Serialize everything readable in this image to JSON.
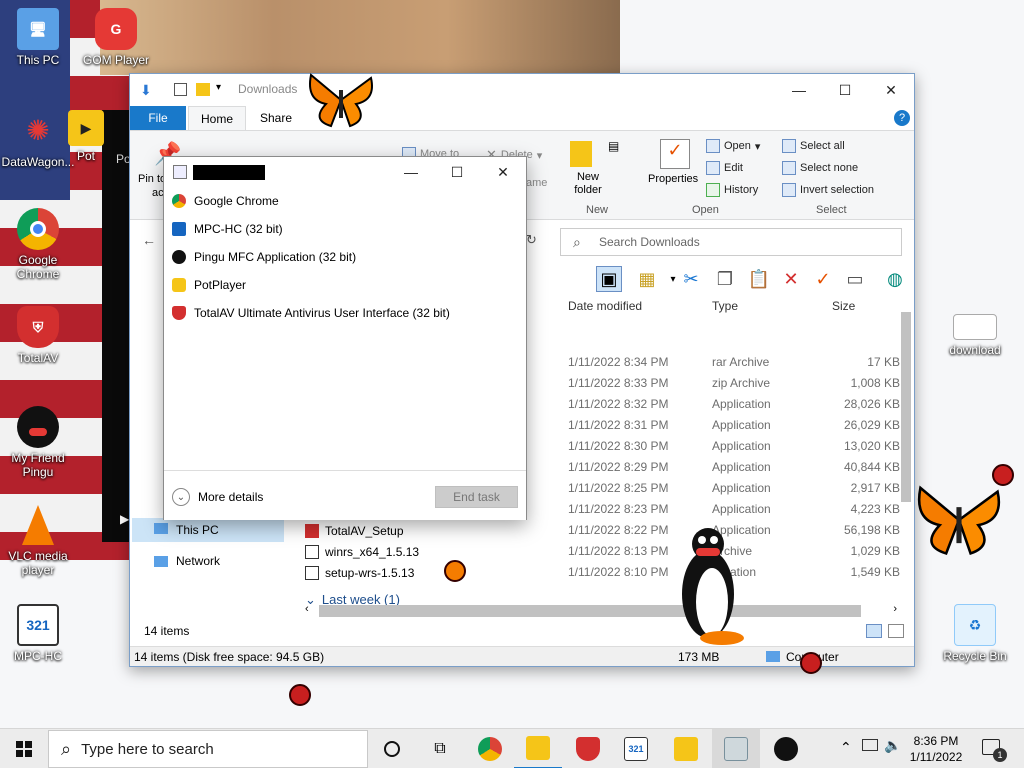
{
  "desktop": {
    "icons": [
      {
        "label": "This PC",
        "icon": "monitor-icon",
        "color": "#1e88e5"
      },
      {
        "label": "GOM Player",
        "icon": "gom-player-icon",
        "color": "#e53935"
      },
      {
        "label": "DataWagon...",
        "icon": "datawagon-icon",
        "color": "#e53935"
      },
      {
        "label": "Pot",
        "icon": "potplayer-icon",
        "color": "#f5c518"
      },
      {
        "label": "Google Chrome",
        "icon": "chrome-icon",
        "color": "#4caf50"
      },
      {
        "label": "TotalAV",
        "icon": "totalav-icon",
        "color": "#d32f2f"
      },
      {
        "label": "My Friend Pingu",
        "icon": "pingu-icon",
        "color": "#111111"
      },
      {
        "label": "VLC media player",
        "icon": "vlc-icon",
        "color": "#f57c00"
      },
      {
        "label": "MPC-HC",
        "icon": "mpc-hc-icon",
        "color": "#1565c0"
      },
      {
        "label": "download",
        "icon": "image-file-icon",
        "color": "#ffffff"
      },
      {
        "label": "Recycle Bin",
        "icon": "recycle-bin-icon",
        "color": "#90caf9"
      }
    ],
    "gom_window_label": "Po"
  },
  "explorer": {
    "title": "Downloads",
    "tabs": {
      "file": "File",
      "home": "Home",
      "share": "Share"
    },
    "ribbon": {
      "pin": "Pin to",
      "pin2": "ac",
      "move_to": "Move to",
      "delete": "Delete",
      "rename": "ame",
      "new_folder": "New folder",
      "properties": "Properties",
      "open": "Open",
      "edit": "Edit",
      "history": "History",
      "select_all": "Select all",
      "select_none": "Select none",
      "invert_selection": "Invert selection",
      "group_new": "New",
      "group_open": "Open",
      "group_select": "Select"
    },
    "search_placeholder": "Search Downloads",
    "columns": {
      "date": "Date modified",
      "type": "Type",
      "size": "Size"
    },
    "rows": [
      {
        "date": "1/11/2022 8:34 PM",
        "type": "rar Archive",
        "size": "17 KB"
      },
      {
        "date": "1/11/2022 8:33 PM",
        "type": "zip Archive",
        "size": "1,008 KB"
      },
      {
        "date": "1/11/2022 8:32 PM",
        "type": "Application",
        "size": "28,026 KB"
      },
      {
        "date": "1/11/2022 8:31 PM",
        "type": "Application",
        "size": "26,029 KB"
      },
      {
        "date": "1/11/2022 8:30 PM",
        "type": "Application",
        "size": "13,020 KB"
      },
      {
        "date": "1/11/2022 8:29 PM",
        "type": "Application",
        "size": "40,844 KB"
      },
      {
        "date": "1/11/2022 8:25 PM",
        "type": "Application",
        "size": "2,917 KB"
      },
      {
        "date": "1/11/2022 8:23 PM",
        "type": "Application",
        "size": "4,223 KB"
      },
      {
        "date": "1/11/2022 8:22 PM",
        "type": "Application",
        "size": "56,198 KB"
      },
      {
        "date": "1/11/2022 8:13 PM",
        "type": "Archive",
        "size": "1,029 KB"
      },
      {
        "date": "1/11/2022 8:10 PM",
        "type": "plication",
        "size": "1,549 KB"
      }
    ],
    "named_files": [
      "TotalAV_Setup",
      "winrs_x64_1.5.13",
      "setup-wrs-1.5.13"
    ],
    "group_last_week": "Last week (1)",
    "nav": {
      "this_pc": "This PC",
      "network": "Network"
    },
    "item_count": "14 items",
    "status_left": "14 items (Disk free space: 94.5 GB)",
    "status_size": "173 MB",
    "status_right": "Computer"
  },
  "popup": {
    "items": [
      {
        "label": "Google Chrome",
        "color": "#4caf50",
        "icon": "chrome-icon"
      },
      {
        "label": "MPC-HC (32 bit)",
        "color": "#1565c0",
        "icon": "mpc-hc-icon"
      },
      {
        "label": "Pingu MFC Application (32 bit)",
        "color": "#111111",
        "icon": "pingu-icon"
      },
      {
        "label": "PotPlayer",
        "color": "#f5c518",
        "icon": "potplayer-icon"
      },
      {
        "label": "TotalAV Ultimate Antivirus User Interface (32 bit)",
        "color": "#d32f2f",
        "icon": "totalav-icon"
      }
    ],
    "more_details": "More details",
    "end_task": "End task"
  },
  "taskbar": {
    "search_placeholder": "Type here to search",
    "time": "8:36 PM",
    "date": "1/11/2022",
    "notification_count": "1",
    "apps": [
      {
        "name": "task-view-icon",
        "color": "#222222"
      },
      {
        "name": "chrome-icon",
        "color": "#4caf50"
      },
      {
        "name": "file-explorer-icon",
        "color": "#f5c518"
      },
      {
        "name": "totalav-icon",
        "color": "#d32f2f"
      },
      {
        "name": "mpc-hc-icon",
        "color": "#1565c0"
      },
      {
        "name": "potplayer-icon",
        "color": "#f5c518"
      },
      {
        "name": "task-manager-icon",
        "color": "#90a4ae"
      },
      {
        "name": "pingu-icon",
        "color": "#111111"
      }
    ]
  }
}
